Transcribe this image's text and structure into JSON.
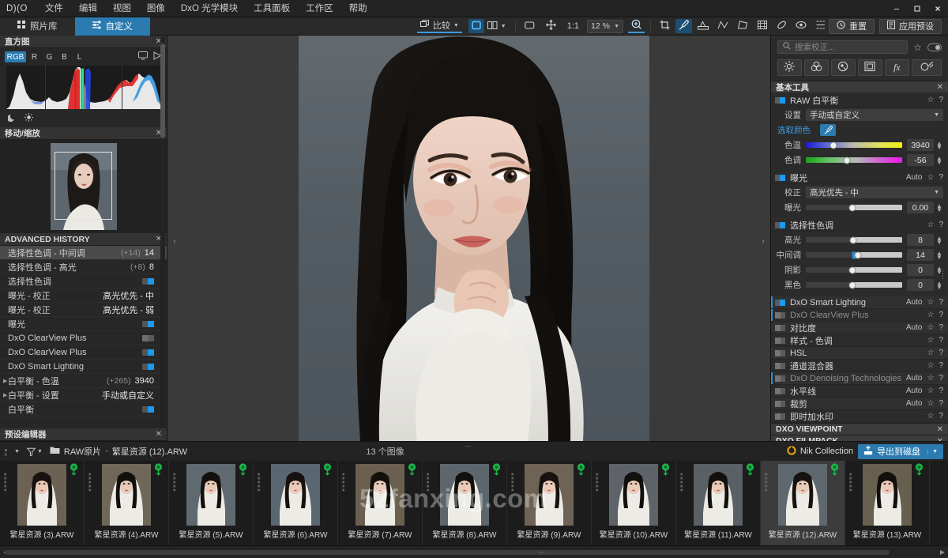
{
  "app": {
    "logo": "D)(O",
    "menus": [
      "文件",
      "编辑",
      "视图",
      "图像",
      "DxO 光学模块",
      "工具面板",
      "工作区",
      "帮助"
    ],
    "window_controls": {
      "minimize": "—",
      "maximize": "❐",
      "close": "✕"
    }
  },
  "toolbar": {
    "tabs": [
      {
        "label": "照片库",
        "icon": "grid-icon",
        "active": false
      },
      {
        "label": "自定义",
        "icon": "sliders-icon",
        "active": true
      }
    ],
    "compare_label": "比较",
    "view_single_icon": "single-view-icon",
    "view_split_icon": "split-view-icon",
    "fit_icon": "fit-screen-icon",
    "pan_icon": "pan-icon",
    "one_to_one": "1:1",
    "zoom_value": "12 %",
    "zoom_in_icon": "zoom-in-icon",
    "tools": [
      {
        "name": "crop-tool",
        "icon": "crop-icon",
        "active": false
      },
      {
        "name": "white-balance-picker-tool",
        "icon": "eyedropper-icon",
        "active": true
      },
      {
        "name": "perspective-tool",
        "icon": "perspective-icon",
        "active": false
      },
      {
        "name": "horizon-tool",
        "icon": "horizon-icon",
        "active": false
      },
      {
        "name": "keystone-tool",
        "icon": "keystone-icon",
        "active": false
      },
      {
        "name": "volume-deform-tool",
        "icon": "volume-icon",
        "active": false
      },
      {
        "name": "grid-tool",
        "icon": "grid-frame-icon",
        "active": false
      },
      {
        "name": "repair-tool",
        "icon": "eraser-icon",
        "active": false
      },
      {
        "name": "local-adjust-tool",
        "icon": "eye-icon",
        "active": false
      },
      {
        "name": "more-tool",
        "icon": "dotted-icon",
        "active": false
      }
    ],
    "reset_label": "重置",
    "apply_preset_label": "应用预设"
  },
  "left_panel": {
    "histogram": {
      "title": "直方图",
      "channels": [
        "RGB",
        "R",
        "G",
        "B",
        "L"
      ],
      "active_channel": "RGB",
      "icons": [
        "monitor-icon",
        "gamut-warning-icon"
      ],
      "footer_icons": [
        "shadow-clipping-icon",
        "highlight-clipping-icon"
      ]
    },
    "navigator": {
      "title": "移动/缩放"
    },
    "history": {
      "title": "ADVANCED HISTORY",
      "rows": [
        {
          "label": "选择性色调 - 中间调",
          "delta": "(+14)",
          "value": "14",
          "selected": true,
          "expandable": false,
          "toggle": null
        },
        {
          "label": "选择性色调 - 高光",
          "delta": "(+8)",
          "value": "8",
          "selected": false,
          "expandable": false,
          "toggle": null
        },
        {
          "label": "选择性色调",
          "delta": "",
          "value": "",
          "selected": false,
          "expandable": false,
          "toggle": "on"
        },
        {
          "label": "曝光 - 校正",
          "delta": "",
          "value": "高光优先 - 中",
          "selected": false,
          "expandable": false,
          "toggle": null
        },
        {
          "label": "曝光 - 校正",
          "delta": "",
          "value": "高光优先 - 弱",
          "selected": false,
          "expandable": false,
          "toggle": null
        },
        {
          "label": "曝光",
          "delta": "",
          "value": "",
          "selected": false,
          "expandable": false,
          "toggle": "on"
        },
        {
          "label": "DxO ClearView Plus",
          "delta": "",
          "value": "",
          "selected": false,
          "expandable": false,
          "toggle": "off"
        },
        {
          "label": "DxO ClearView Plus",
          "delta": "",
          "value": "",
          "selected": false,
          "expandable": false,
          "toggle": "on"
        },
        {
          "label": "DxO Smart Lighting",
          "delta": "",
          "value": "",
          "selected": false,
          "expandable": false,
          "toggle": "on"
        },
        {
          "label": "白平衡 - 色温",
          "delta": "(+265)",
          "value": "3940",
          "selected": false,
          "expandable": true,
          "toggle": null
        },
        {
          "label": "白平衡 - 设置",
          "delta": "",
          "value": "手动或自定义",
          "selected": false,
          "expandable": true,
          "toggle": null
        },
        {
          "label": "白平衡",
          "delta": "",
          "value": "",
          "selected": false,
          "expandable": false,
          "toggle": "on"
        }
      ]
    },
    "preset_editor": {
      "title": "预设编辑器"
    }
  },
  "right_panel": {
    "search": {
      "placeholder": "搜索校正...",
      "icon": "search-icon"
    },
    "search_actions": [
      "favorite-star-icon",
      "toggle-all-icon"
    ],
    "categories": [
      {
        "name": "light-category",
        "icon": "brightness-icon"
      },
      {
        "name": "color-category",
        "icon": "color-circles-icon"
      },
      {
        "name": "detail-category",
        "icon": "detail-icon"
      },
      {
        "name": "geometry-category",
        "icon": "geometry-icon"
      },
      {
        "name": "effects-category",
        "icon": "fx-icon"
      },
      {
        "name": "local-adjust-category",
        "icon": "local-brush-icon"
      }
    ],
    "section_title": "基本工具",
    "raw_wb": {
      "title": "RAW 白平衡",
      "enabled": true,
      "setting_label": "设置",
      "setting_value": "手动或自定义",
      "picker_label": "选取颜色",
      "temp_label": "色温",
      "temp_value": "3940",
      "tint_label": "色调",
      "tint_value": "-56"
    },
    "exposure": {
      "title": "曝光",
      "enabled": true,
      "auto": "Auto",
      "correction_label": "校正",
      "correction_value": "高光优先 - 中",
      "exposure_label": "曝光",
      "exposure_value": "0.00"
    },
    "selective_tone": {
      "title": "选择性色调",
      "enabled": true,
      "sliders": [
        {
          "label": "高光",
          "value": "8",
          "pos": 49
        },
        {
          "label": "中间调",
          "value": "14",
          "pos": 54
        },
        {
          "label": "阴影",
          "value": "0",
          "pos": 48
        },
        {
          "label": "黑色",
          "value": "0",
          "pos": 48
        }
      ]
    },
    "tool_rows": [
      {
        "label": "DxO Smart Lighting",
        "auto": "Auto",
        "toggle": "on",
        "dim": false,
        "marked": true
      },
      {
        "label": "DxO ClearView Plus",
        "auto": "",
        "toggle": "off",
        "dim": true,
        "marked": true
      },
      {
        "label": "对比度",
        "auto": "Auto",
        "toggle": "off",
        "dim": false,
        "marked": false
      },
      {
        "label": "样式 - 色调",
        "auto": "",
        "toggle": "off",
        "dim": false,
        "marked": false
      },
      {
        "label": "HSL",
        "auto": "",
        "toggle": "off",
        "dim": false,
        "marked": false
      },
      {
        "label": "通道混合器",
        "auto": "",
        "toggle": "off",
        "dim": false,
        "marked": false
      },
      {
        "label": "DxO Denoising Technologies",
        "auto": "Auto",
        "toggle": "off",
        "dim": true,
        "marked": true
      },
      {
        "label": "水平线",
        "auto": "Auto",
        "toggle": "off",
        "dim": false,
        "marked": false
      },
      {
        "label": "裁剪",
        "auto": "Auto",
        "toggle": "off",
        "dim": false,
        "marked": false
      },
      {
        "label": "即时加水印",
        "auto": "",
        "toggle": "off",
        "dim": false,
        "marked": false
      }
    ],
    "extra_sections": [
      "DXO VIEWPOINT",
      "DXO FILMPACK"
    ],
    "help_glyph": "?",
    "star_glyph": "☆"
  },
  "status_bar": {
    "sort_icon": "sort-icon",
    "filter_icon": "filter-icon",
    "folder_icon": "folder-icon",
    "folder_name": "RAW原片",
    "separator": "·",
    "current_file": "繁星资源 (12).ARW",
    "image_count": "13 个图像",
    "nik_label": "Nik Collection",
    "export_label": "导出到磁盘"
  },
  "filmstrip": {
    "watermark": "52fanxing.com",
    "items": [
      {
        "name": "繁星资源 (3).ARW",
        "selected": false
      },
      {
        "name": "繁星资源 (4).ARW",
        "selected": false
      },
      {
        "name": "繁星资源 (5).ARW",
        "selected": false
      },
      {
        "name": "繁星资源 (6).ARW",
        "selected": false
      },
      {
        "name": "繁星资源 (7).ARW",
        "selected": false
      },
      {
        "name": "繁星资源 (8).ARW",
        "selected": false
      },
      {
        "name": "繁星资源 (9).ARW",
        "selected": false
      },
      {
        "name": "繁星资源 (10).ARW",
        "selected": false
      },
      {
        "name": "繁星资源 (11).ARW",
        "selected": false
      },
      {
        "name": "繁星资源 (12).ARW",
        "selected": true
      },
      {
        "name": "繁星资源 (13).ARW",
        "selected": false
      }
    ]
  },
  "colors": {
    "accent": "#2b7ab0",
    "accent_bright": "#1b9af0",
    "panel_bg": "#2b2b2b",
    "canvas_bg": "#3a3a3a",
    "badge_green": "#19b84a"
  }
}
